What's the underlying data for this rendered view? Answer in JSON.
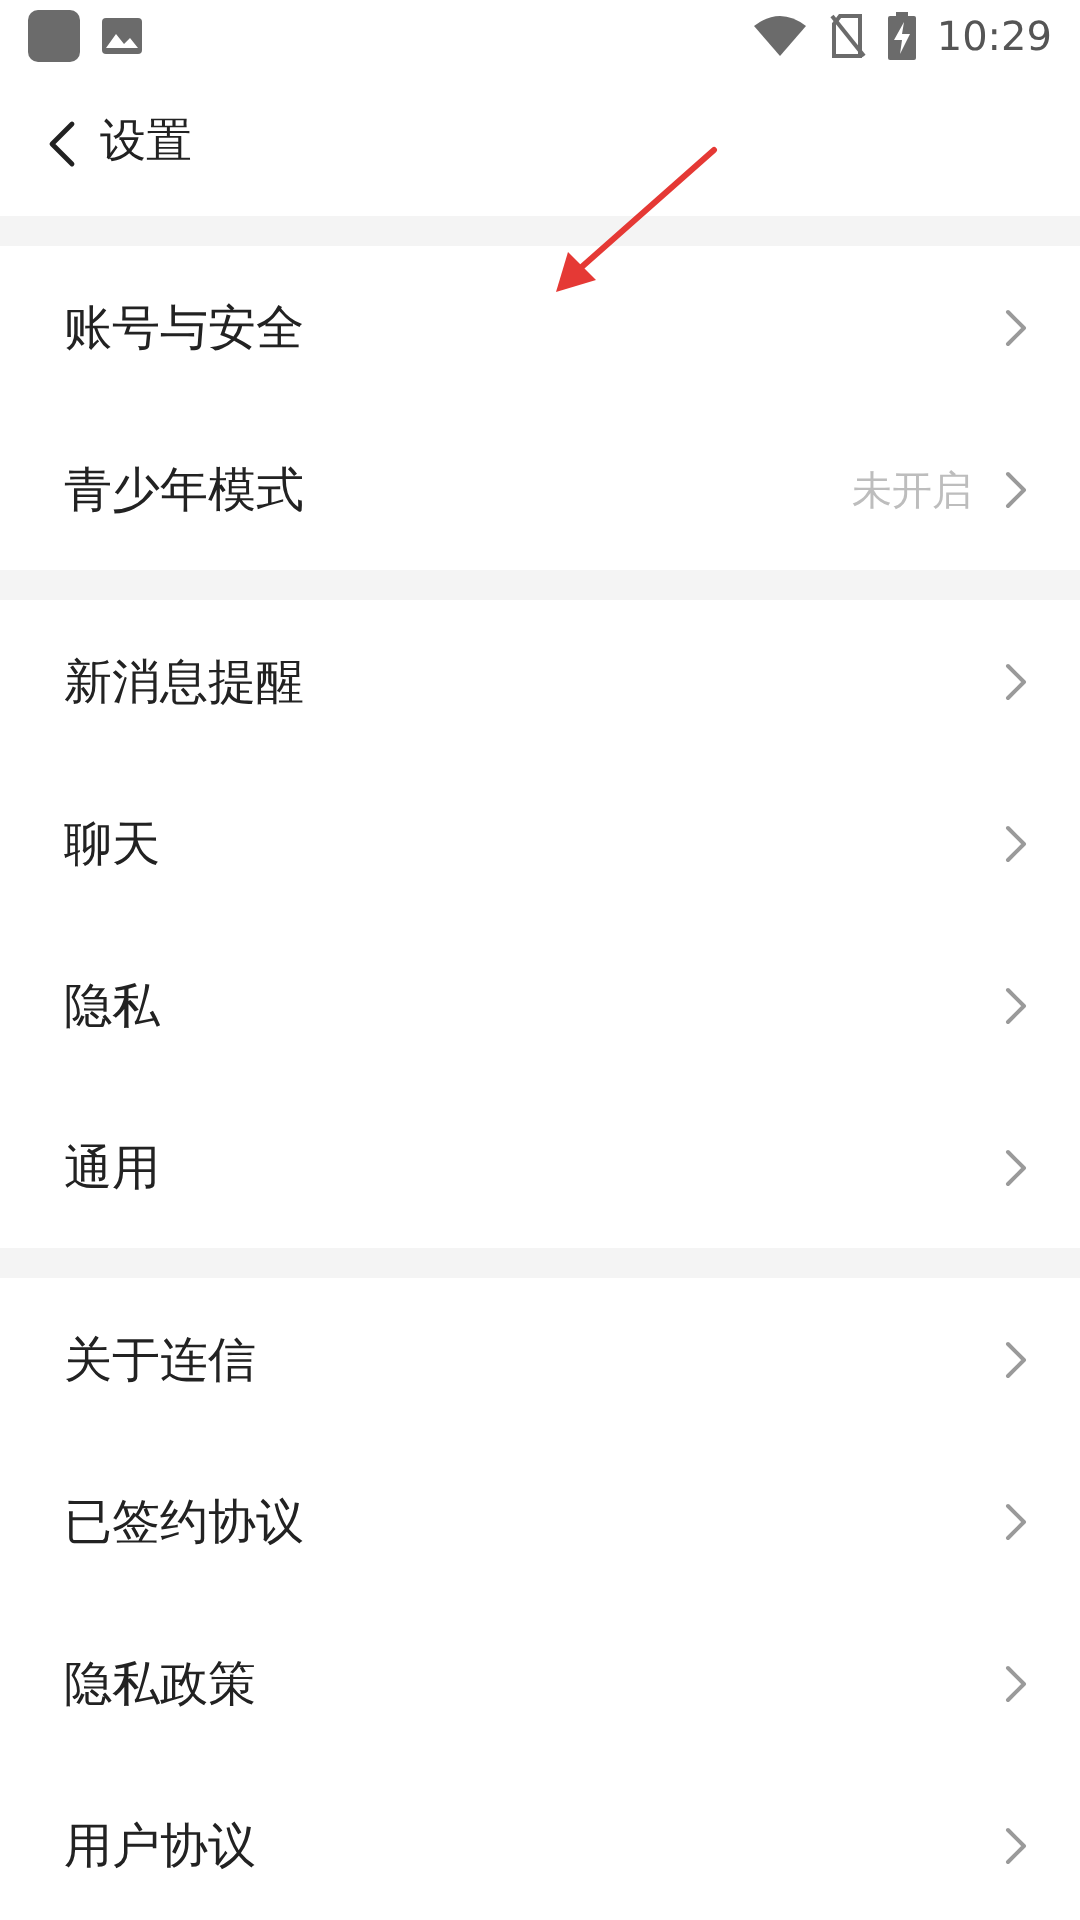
{
  "status_bar": {
    "time": "10:29"
  },
  "header": {
    "title": "设置"
  },
  "groups": [
    {
      "items": [
        {
          "label": "账号与安全"
        },
        {
          "label": "青少年模式",
          "value": "未开启"
        }
      ]
    },
    {
      "items": [
        {
          "label": "新消息提醒"
        },
        {
          "label": "聊天"
        },
        {
          "label": "隐私"
        },
        {
          "label": "通用"
        }
      ]
    },
    {
      "items": [
        {
          "label": "关于连信"
        },
        {
          "label": "已签约协议"
        },
        {
          "label": "隐私政策"
        },
        {
          "label": "用户协议"
        }
      ]
    }
  ]
}
